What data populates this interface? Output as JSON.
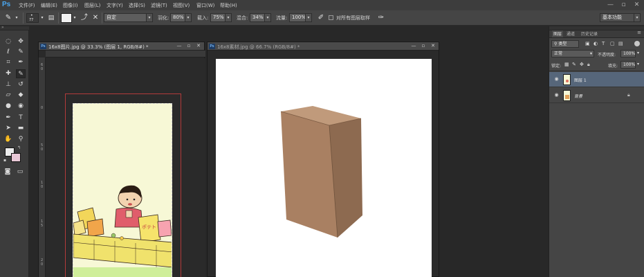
{
  "app": {
    "logo": "Ps"
  },
  "menu": [
    "文件(F)",
    "编辑(E)",
    "图像(I)",
    "图层(L)",
    "文字(Y)",
    "选择(S)",
    "滤镜(T)",
    "视图(V)",
    "窗口(W)",
    "帮助(H)"
  ],
  "window_controls": {
    "minimize": "—",
    "restore": "▫",
    "close": "✕"
  },
  "options": {
    "brush_size": "77",
    "style_value": "自定",
    "feather_label": "羽化:",
    "feather_value": "80%",
    "load_label": "载入:",
    "load_value": "75%",
    "mix_label": "混合:",
    "mix_value": "34%",
    "flow_label": "流量:",
    "flow_value": "100%",
    "sample_all_label": "对所有图层取样",
    "workspace": "基本功能"
  },
  "doc1": {
    "title": "16x8图片.jpg @ 33.3% (图层 1, RGB/8#) *",
    "ruler_v": [
      "6",
      "0",
      "0",
      "5",
      "0",
      "1",
      "0",
      "1",
      "5",
      "2",
      "0"
    ]
  },
  "doc2": {
    "title": "16x8素材.jpg @ 66.7% (RGB/8#) *"
  },
  "panels": {
    "tabs": [
      "图层",
      "通道",
      "历史记录"
    ],
    "filter_kind": "类型",
    "blend_mode": "正常",
    "opacity_label": "不透明度:",
    "opacity_value": "100%",
    "lock_label": "锁定:",
    "fill_label": "填充:",
    "fill_value": "100%",
    "layers": [
      {
        "name": "图层 1",
        "selected": true
      },
      {
        "name": "背景",
        "selected": false,
        "locked": true
      }
    ]
  },
  "colors": {
    "accent": "#4aa7f0",
    "selected_layer": "#56667a",
    "box_tan": "#a98062",
    "artwork_bg": "#f7f8d6"
  }
}
